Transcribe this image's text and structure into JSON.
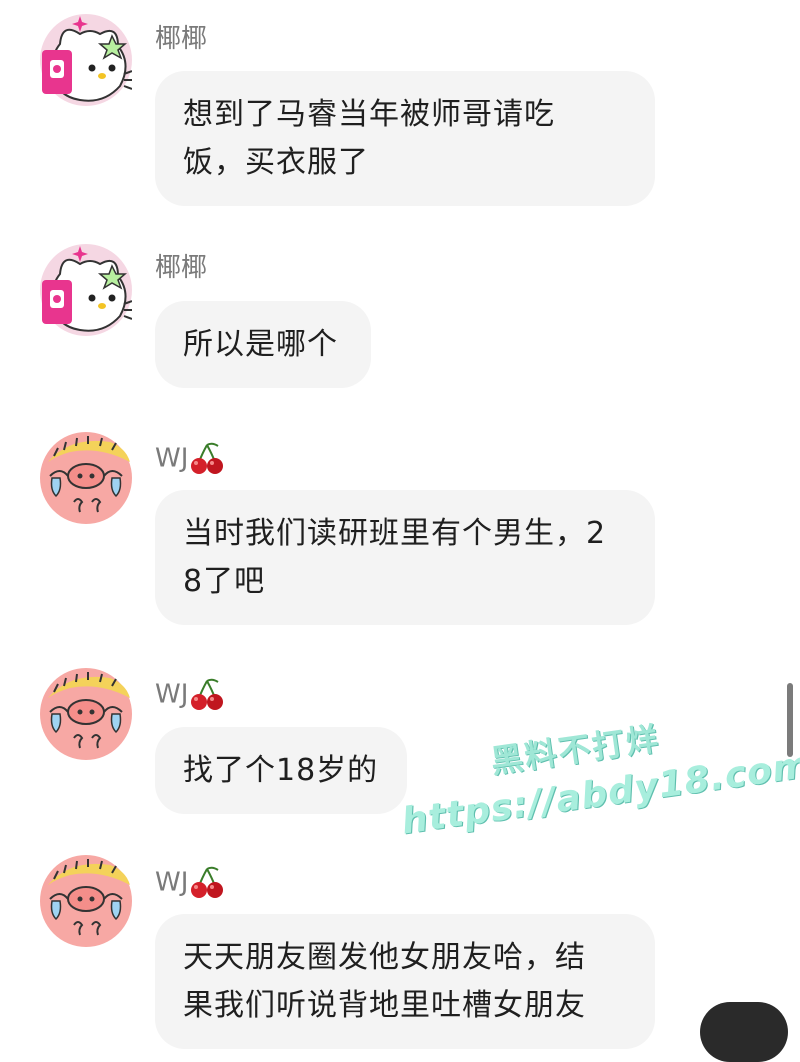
{
  "messages": [
    {
      "sender": "椰椰",
      "avatar": "hello-kitty-avatar",
      "lines": [
        "想到了马睿当年被师哥请吃",
        "饭，买衣服了"
      ]
    },
    {
      "sender": "椰椰",
      "avatar": "hello-kitty-avatar",
      "lines": [
        "所以是哪个"
      ]
    },
    {
      "sender": "WJ",
      "sender_emoji": "cherry-icon",
      "avatar": "crying-pig-avatar",
      "lines": [
        "当时我们读研班里有个男生，2",
        "8了吧"
      ]
    },
    {
      "sender": "WJ",
      "sender_emoji": "cherry-icon",
      "avatar": "crying-pig-avatar",
      "lines": [
        "找了个18岁的"
      ]
    },
    {
      "sender": "WJ",
      "sender_emoji": "cherry-icon",
      "avatar": "crying-pig-avatar",
      "lines": [
        "天天朋友圈发他女朋友哈，结",
        "果我们听说背地里吐槽女朋友"
      ]
    }
  ],
  "watermark": {
    "line1": "黑料不打烊",
    "line2": "https://abdy18.com"
  },
  "colors": {
    "bubble": "#f4f4f4",
    "sender": "#7a7a7a",
    "text": "#1f1f1f",
    "watermark": "#9fe7d6"
  }
}
